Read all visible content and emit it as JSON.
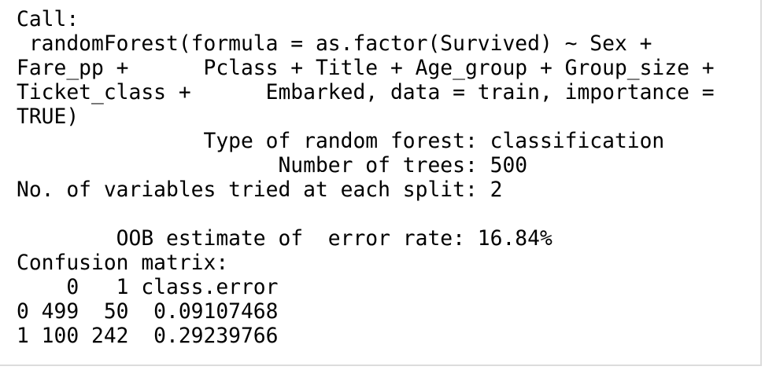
{
  "console": {
    "lines": [
      "Call:",
      " randomForest(formula = as.factor(Survived) ~ Sex + ",
      "Fare_pp +      Pclass + Title + Age_group + Group_size + ",
      "Ticket_class +      Embarked, data = train, importance = ",
      "TRUE) ",
      "               Type of random forest: classification",
      "                     Number of trees: 500",
      "No. of variables tried at each split: 2",
      "",
      "        OOB estimate of  error rate: 16.84%",
      "Confusion matrix:",
      "    0   1 class.error",
      "0 499  50  0.09107468",
      "1 100 242  0.29239766"
    ]
  }
}
